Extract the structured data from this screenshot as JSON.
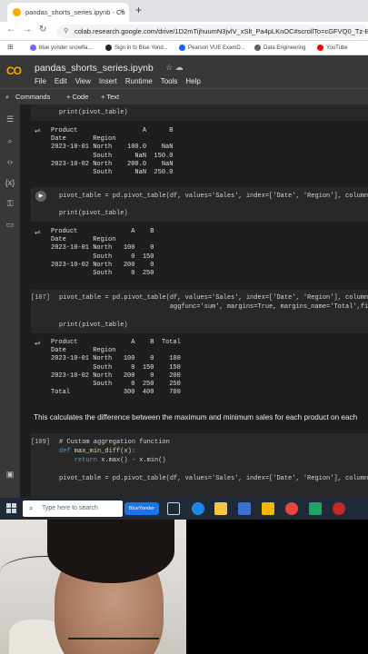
{
  "browser": {
    "tab_title": "pandas_shorts_series.ipynb - Co",
    "tab_close": "×",
    "new_tab": "+",
    "url": "colab.research.google.com/drive/1D2mTijhuumN3jvlV_xSlt_Pa4pLKnOC#scrollTo=cGFVQ0_Tz-B7",
    "back": "←",
    "forward": "→",
    "reload": "↻",
    "bookmarks": [
      {
        "label": "blue yonder snowfla...",
        "color": "#7b61ff"
      },
      {
        "label": "Sign in to Blue Yond...",
        "color": "#202124"
      },
      {
        "label": "Pearson VUE ExamD...",
        "color": "#0f62fe"
      },
      {
        "label": "Data Engineering",
        "color": "#5f6368"
      },
      {
        "label": "YouTube",
        "color": "#ff0000"
      }
    ]
  },
  "colab": {
    "logo": "CO",
    "notebook_title": "pandas_shorts_series.ipynb",
    "title_icons": "☆  ☁",
    "menu": [
      "File",
      "Edit",
      "View",
      "Insert",
      "Runtime",
      "Tools",
      "Help"
    ],
    "toolbar": {
      "commands": "Commands",
      "add_code": "+ Code",
      "add_text": "+ Text"
    }
  },
  "cells": {
    "c0_code": "print(pivot_table)",
    "o0_lines": "Product                 A      B\nDate       Region\n2023-10-01 North    100.0    NaN\n           South      NaN  150.0\n2023-10-02 North    200.0    NaN\n           South      NaN  250.0",
    "c1_line1": "pivot_table = pd.pivot_table(df, values='Sales', index=['Date', 'Region'], columns=",
    "c1_line2": "print(pivot_table)",
    "o1_lines": "Product              A    B\nDate       Region\n2023-10-01 North   100    0\n           South     0  150\n2023-10-02 North   200    0\n           South     0  250",
    "c2_exec": "[107]",
    "c2_line1": "pivot_table = pd.pivot_table(df, values='Sales', index=['Date', 'Region'], columns=",
    "c2_line2": "                             aggfunc='sum', margins=True, margins_name='Total',fill_",
    "c2_line3": "print(pivot_table)",
    "o2_lines": "Product              A    B  Total\nDate       Region\n2023-10-01 North   100    0    100\n           South     0  150    150\n2023-10-02 North   200    0    200\n           South     0  250    250\nTotal              300  400    700",
    "md_text": "This calculates the difference between the maximum and minimum sales for each product on each",
    "c3_exec": "[109]",
    "c3_line1": "# Custom aggregation function",
    "c3_line2_kw": "def",
    "c3_line2_fn": " max_min_diff(x):",
    "c3_line3_kw": "    return",
    "c3_line3": " x.max() - x.min()",
    "c3_line4": "pivot_table = pd.pivot_table(df, values='Sales', index=['Date', 'Region'], columns="
  },
  "taskbar": {
    "search_placeholder": "Type here to search",
    "blueyonder_badge": "BlueYonder"
  }
}
